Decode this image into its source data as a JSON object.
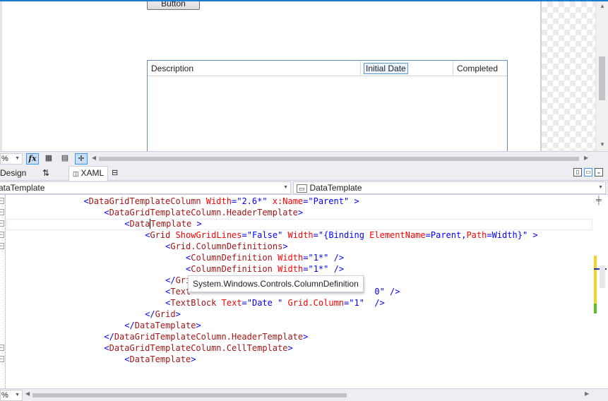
{
  "designer": {
    "button_label": "Button",
    "datagrid": {
      "columns": [
        "Description",
        "Initial Date",
        "Completed"
      ],
      "selected_column": "Initial Date"
    }
  },
  "designer_toolbar": {
    "zoom_value": "%",
    "fx_label": "fx"
  },
  "tabs": {
    "design": "Design",
    "swap": "⇅",
    "xaml": "XAML",
    "xaml_icon": "◫",
    "expand": "⊟"
  },
  "navigation": {
    "left_combo": "ataTemplate",
    "right_combo": "DataTemplate"
  },
  "editor": {
    "lines": [
      {
        "indent": 15,
        "parts": [
          [
            "punct",
            "<"
          ],
          [
            "tag",
            "DataGridTemplateColumn"
          ],
          [
            "attr",
            " Width"
          ],
          [
            "punct",
            "=\""
          ],
          [
            "val",
            "2.6*"
          ],
          [
            "punct",
            "\""
          ],
          [
            "attr",
            " x:Name"
          ],
          [
            "punct",
            "=\""
          ],
          [
            "val",
            "Parent"
          ],
          [
            "punct",
            "\" >"
          ]
        ]
      },
      {
        "indent": 19,
        "parts": [
          [
            "punct",
            "<"
          ],
          [
            "tag",
            "DataGridTemplateColumn.HeaderTemplate"
          ],
          [
            "punct",
            ">"
          ]
        ]
      },
      {
        "indent": 23,
        "parts": [
          [
            "punct",
            "<"
          ],
          [
            "tag",
            "Data"
          ],
          [
            "caret",
            ""
          ],
          [
            "tag",
            "Template"
          ],
          [
            "punct",
            " >"
          ]
        ]
      },
      {
        "indent": 27,
        "parts": [
          [
            "punct",
            "<"
          ],
          [
            "tag",
            "Grid"
          ],
          [
            "attr",
            " ShowGridLines"
          ],
          [
            "punct",
            "=\""
          ],
          [
            "val",
            "False"
          ],
          [
            "punct",
            "\""
          ],
          [
            "attr",
            " Width"
          ],
          [
            "punct",
            "=\""
          ],
          [
            "val",
            "{Binding "
          ],
          [
            "attr",
            "ElementName"
          ],
          [
            "punct",
            "="
          ],
          [
            "val",
            "Parent,"
          ],
          [
            "attr",
            "Path"
          ],
          [
            "punct",
            "="
          ],
          [
            "val",
            "Width}"
          ],
          [
            "punct",
            "\" >"
          ]
        ]
      },
      {
        "indent": 31,
        "parts": [
          [
            "punct",
            "<"
          ],
          [
            "tag",
            "Grid.ColumnDefinitions"
          ],
          [
            "punct",
            ">"
          ]
        ]
      },
      {
        "indent": 35,
        "parts": [
          [
            "punct",
            "<"
          ],
          [
            "tag",
            "ColumnDefinition"
          ],
          [
            "attr",
            " Width"
          ],
          [
            "punct",
            "=\""
          ],
          [
            "val",
            "1*"
          ],
          [
            "punct",
            "\" />"
          ]
        ]
      },
      {
        "indent": 35,
        "parts": [
          [
            "punct",
            "<"
          ],
          [
            "tag",
            "ColumnDefinition"
          ],
          [
            "attr",
            " Width"
          ],
          [
            "punct",
            "=\""
          ],
          [
            "val",
            "1*"
          ],
          [
            "punct",
            "\" />"
          ]
        ]
      },
      {
        "indent": 31,
        "parts": [
          [
            "punct",
            "</"
          ],
          [
            "tag",
            "Gri"
          ]
        ]
      },
      {
        "indent": 31,
        "parts": [
          [
            "punct",
            "<"
          ],
          [
            "tag",
            "Text"
          ],
          [
            "pad",
            "                                    "
          ],
          [
            "val",
            "0"
          ],
          [
            "punct",
            "\" />"
          ]
        ]
      },
      {
        "indent": 31,
        "parts": [
          [
            "punct",
            "<"
          ],
          [
            "tag",
            "TextBlock"
          ],
          [
            "attr",
            " Text"
          ],
          [
            "punct",
            "=\""
          ],
          [
            "val",
            "Date "
          ],
          [
            "punct",
            "\""
          ],
          [
            "attr",
            " Grid.Column"
          ],
          [
            "punct",
            "=\""
          ],
          [
            "val",
            "1"
          ],
          [
            "punct",
            "\"  />"
          ]
        ]
      },
      {
        "indent": 27,
        "parts": [
          [
            "punct",
            "</"
          ],
          [
            "tag",
            "Grid"
          ],
          [
            "punct",
            ">"
          ]
        ]
      },
      {
        "indent": 23,
        "parts": [
          [
            "punct",
            "</"
          ],
          [
            "tag",
            "DataTemplate"
          ],
          [
            "punct",
            ">"
          ]
        ]
      },
      {
        "indent": 19,
        "parts": [
          [
            "punct",
            "</"
          ],
          [
            "tag",
            "DataGridTemplateColumn.HeaderTemplate"
          ],
          [
            "punct",
            ">"
          ]
        ]
      },
      {
        "indent": 19,
        "parts": [
          [
            "punct",
            "<"
          ],
          [
            "tag",
            "DataGridTemplateColumn.CellTemplate"
          ],
          [
            "punct",
            ">"
          ]
        ]
      },
      {
        "indent": 23,
        "parts": [
          [
            "punct",
            "<"
          ],
          [
            "tag",
            "DataTemplate"
          ],
          [
            "punct",
            ">"
          ]
        ]
      }
    ],
    "tooltip": "System.Windows.Controls.ColumnDefinition"
  },
  "editor_footer": {
    "zoom_value": "%"
  },
  "colors": {
    "xaml_tag": "#a31515",
    "xaml_attribute": "#ff0000",
    "xaml_value": "#0000ff",
    "accent": "#1a7ad4"
  }
}
